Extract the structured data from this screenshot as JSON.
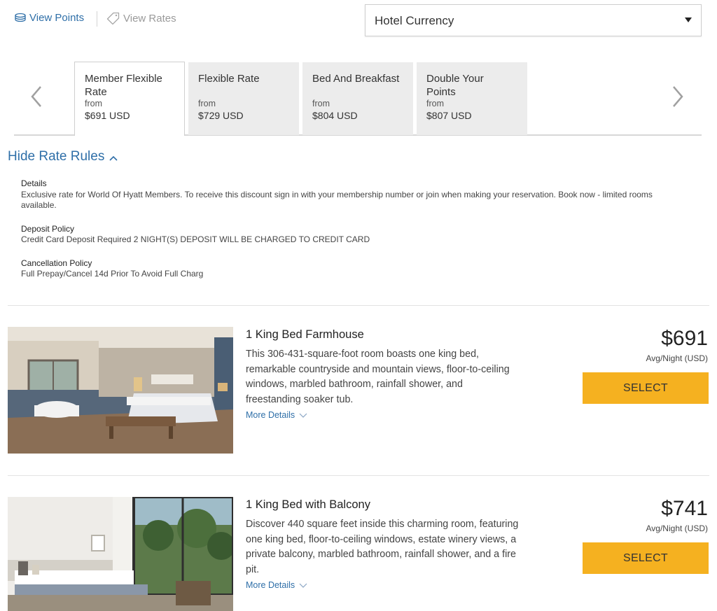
{
  "top": {
    "view_points": "View Points",
    "view_rates": "View Rates",
    "currency": "Hotel Currency"
  },
  "rate_tabs": [
    {
      "name": "Member Flexible Rate",
      "from": "from",
      "price": "$691 USD",
      "active": true
    },
    {
      "name": "Flexible Rate",
      "from": "from",
      "price": "$729 USD",
      "active": false
    },
    {
      "name": "Bed And Breakfast",
      "from": "from",
      "price": "$804 USD",
      "active": false
    },
    {
      "name": "Double Your Points",
      "from": "from",
      "price": "$807 USD",
      "active": false
    }
  ],
  "rules": {
    "toggle_label": "Hide Rate Rules",
    "details_head": "Details",
    "details_body": "Exclusive rate for World Of Hyatt Members. To receive this discount sign in with your membership number or join when making your reservation. Book now - limited rooms available.",
    "deposit_head": "Deposit Policy",
    "deposit_body": "Credit Card Deposit Required 2 NIGHT(S) DEPOSIT WILL BE CHARGED TO CREDIT CARD",
    "cancel_head": "Cancellation Policy",
    "cancel_body": "Full Prepay/Cancel 14d Prior To Avoid Full Charg"
  },
  "rooms": [
    {
      "name": "1 King Bed Farmhouse",
      "description": "This 306-431-square-foot room boasts one king bed, remarkable countryside and mountain views, floor-to-ceiling windows, marbled bathroom, rainfall shower, and freestanding soaker tub.",
      "more": "More Details",
      "price": "$691",
      "avg": "Avg/Night (USD)",
      "select": "SELECT"
    },
    {
      "name": "1 King Bed with Balcony",
      "description": "Discover 440 square feet inside this charming room, featuring one king bed, floor-to-ceiling windows, estate winery views, a private balcony, marbled bathroom, rainfall shower, and a fire pit.",
      "more": "More Details",
      "price": "$741",
      "avg": "Avg/Night (USD)",
      "select": "SELECT"
    }
  ],
  "colors": {
    "link": "#2f6fa8",
    "select_button": "#f5b120",
    "tab_inactive": "#ececec"
  }
}
